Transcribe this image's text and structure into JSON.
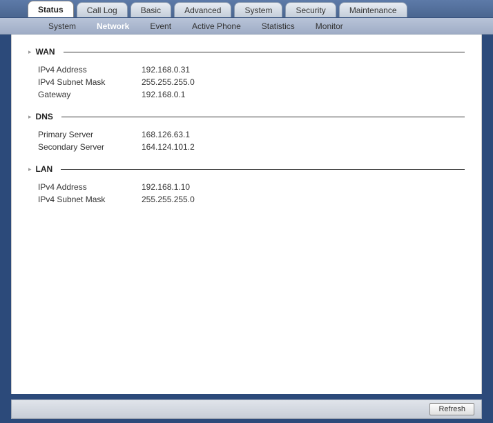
{
  "primaryTabs": [
    {
      "label": "Status",
      "active": true
    },
    {
      "label": "Call Log",
      "active": false
    },
    {
      "label": "Basic",
      "active": false
    },
    {
      "label": "Advanced",
      "active": false
    },
    {
      "label": "System",
      "active": false
    },
    {
      "label": "Security",
      "active": false
    },
    {
      "label": "Maintenance",
      "active": false
    }
  ],
  "subTabs": [
    {
      "label": "System",
      "active": false
    },
    {
      "label": "Network",
      "active": true
    },
    {
      "label": "Event",
      "active": false
    },
    {
      "label": "Active Phone",
      "active": false
    },
    {
      "label": "Statistics",
      "active": false
    },
    {
      "label": "Monitor",
      "active": false
    }
  ],
  "sections": {
    "wan": {
      "title": "WAN",
      "rows": [
        {
          "label": "IPv4 Address",
          "value": "192.168.0.31"
        },
        {
          "label": "IPv4 Subnet Mask",
          "value": "255.255.255.0"
        },
        {
          "label": "Gateway",
          "value": "192.168.0.1"
        }
      ]
    },
    "dns": {
      "title": "DNS",
      "rows": [
        {
          "label": "Primary Server",
          "value": "168.126.63.1"
        },
        {
          "label": "Secondary Server",
          "value": "164.124.101.2"
        }
      ]
    },
    "lan": {
      "title": "LAN",
      "rows": [
        {
          "label": "IPv4 Address",
          "value": "192.168.1.10"
        },
        {
          "label": "IPv4 Subnet Mask",
          "value": "255.255.255.0"
        }
      ]
    }
  },
  "footer": {
    "refresh_label": "Refresh"
  }
}
